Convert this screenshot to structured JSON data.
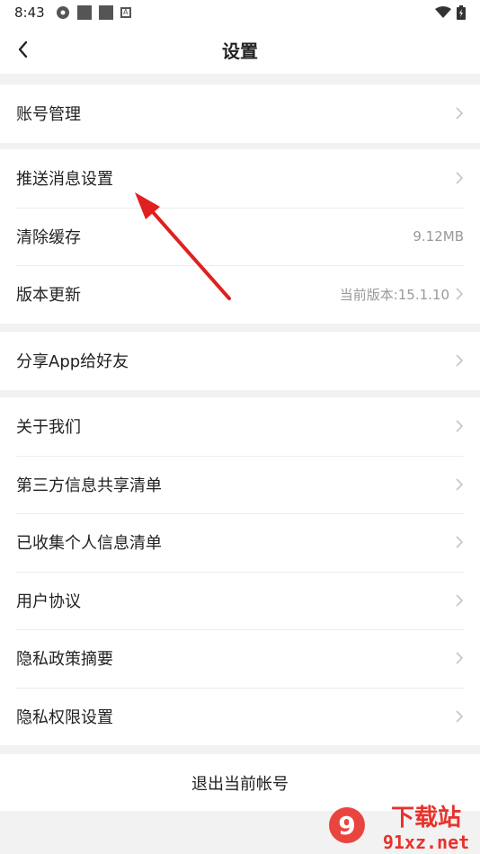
{
  "status_bar": {
    "time": "8:43",
    "icons": [
      "settings-gear-icon",
      "square-icon",
      "square-icon",
      "a-badge-icon",
      "wifi-icon",
      "battery-icon"
    ]
  },
  "header": {
    "title": "设置",
    "back_icon": "chevron-left-icon"
  },
  "groups": [
    {
      "items": [
        {
          "label": "账号管理",
          "value": ""
        }
      ]
    },
    {
      "items": [
        {
          "label": "推送消息设置",
          "value": ""
        },
        {
          "label": "清除缓存",
          "value": "9.12MB"
        },
        {
          "label": "版本更新",
          "value": "当前版本:15.1.10"
        }
      ]
    },
    {
      "items": [
        {
          "label": "分享App给好友",
          "value": ""
        }
      ]
    },
    {
      "items": [
        {
          "label": "关于我们",
          "value": ""
        },
        {
          "label": "第三方信息共享清单",
          "value": ""
        },
        {
          "label": "已收集个人信息清单",
          "value": ""
        },
        {
          "label": "用户协议",
          "value": ""
        },
        {
          "label": "隐私政策摘要",
          "value": ""
        },
        {
          "label": "隐私权限设置",
          "value": ""
        }
      ]
    }
  ],
  "logout_label": "退出当前帐号",
  "watermark": {
    "mark": "9",
    "text": "下载站",
    "url": "91xz.net"
  },
  "colors": {
    "annotation_arrow": "#e02020",
    "watermark_red": "#e8322b"
  }
}
